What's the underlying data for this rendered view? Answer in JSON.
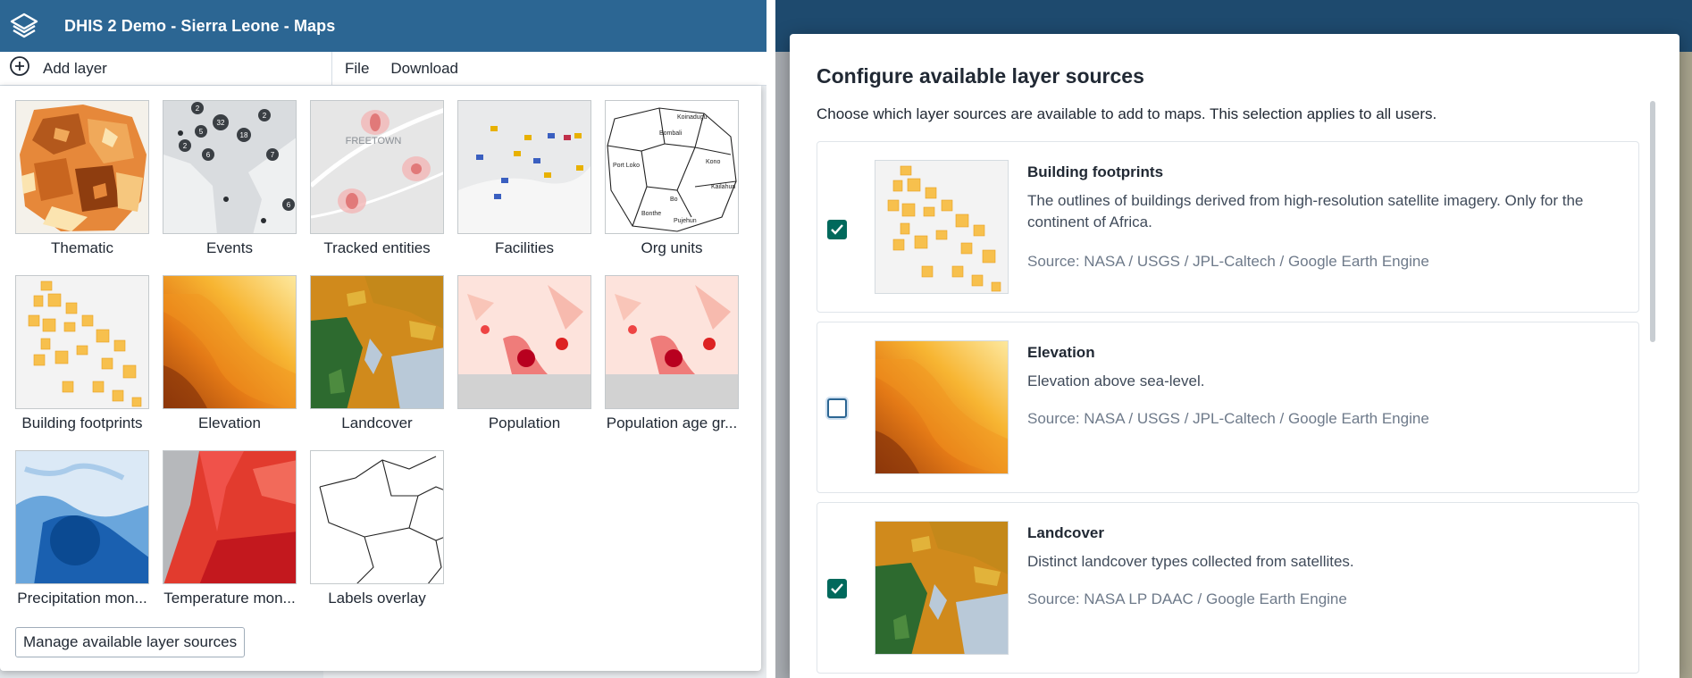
{
  "app": {
    "title": "DHIS 2 Demo - Sierra Leone - Maps"
  },
  "toolbar": {
    "add_layer": "Add layer",
    "file": "File",
    "download": "Download"
  },
  "layers": [
    {
      "label": "Thematic",
      "icon": "thematic-thumbnail"
    },
    {
      "label": "Events",
      "icon": "events-thumbnail"
    },
    {
      "label": "Tracked entities",
      "icon": "tracked-entities-thumbnail"
    },
    {
      "label": "Facilities",
      "icon": "facilities-thumbnail"
    },
    {
      "label": "Org units",
      "icon": "org-units-thumbnail"
    },
    {
      "label": "Building footprints",
      "icon": "building-footprints-thumbnail"
    },
    {
      "label": "Elevation",
      "icon": "elevation-thumbnail"
    },
    {
      "label": "Landcover",
      "icon": "landcover-thumbnail"
    },
    {
      "label": "Population",
      "icon": "population-thumbnail"
    },
    {
      "label": "Population age gr...",
      "icon": "population-age-thumbnail"
    },
    {
      "label": "Precipitation mon...",
      "icon": "precipitation-thumbnail"
    },
    {
      "label": "Temperature mon...",
      "icon": "temperature-thumbnail"
    },
    {
      "label": "Labels overlay",
      "icon": "labels-overlay-thumbnail"
    }
  ],
  "events_thumb_numbers": [
    "2",
    "32",
    "2",
    "5",
    "18",
    "2",
    "6",
    "7",
    "6"
  ],
  "org_units_thumb_names": [
    "Koinadugu",
    "Port Loko",
    "Kono",
    "Bombali",
    "Kailahun",
    "Bo",
    "Bonthe",
    "Pujehun"
  ],
  "thumb_map_labels": {
    "freetown": "FREETOWN"
  },
  "manage_button": "Manage available layer sources",
  "modal": {
    "title": "Configure available layer sources",
    "description": "Choose which layer sources are available to add to maps. This selection applies to all users.",
    "sources": [
      {
        "name": "Building footprints",
        "description": "The outlines of buildings derived from high-resolution satellite imagery. Only for the continent of Africa.",
        "source": "Source: NASA / USGS / JPL-Caltech / Google Earth Engine",
        "checked": true
      },
      {
        "name": "Elevation",
        "description": "Elevation above sea-level.",
        "source": "Source: NASA / USGS / JPL-Caltech / Google Earth Engine",
        "checked": false
      },
      {
        "name": "Landcover",
        "description": "Distinct landcover types collected from satellites.",
        "source": "Source: NASA LP DAAC / Google Earth Engine",
        "checked": true
      }
    ]
  },
  "colors": {
    "header": "#2c6693",
    "checkbox_checked": "#00695c",
    "checkbox_focus": "#2c6693"
  }
}
